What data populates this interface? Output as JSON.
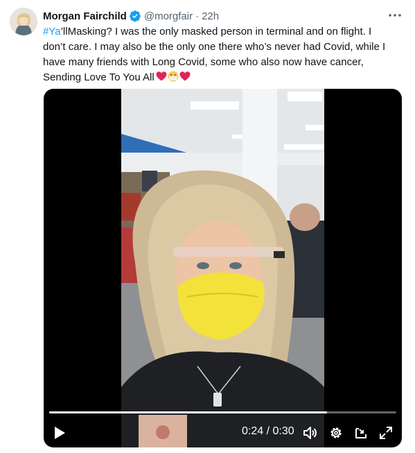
{
  "author": {
    "name": "Morgan Fairchild",
    "handle": "@morgfair",
    "separator": "·",
    "time": "22h",
    "verified": true,
    "verified_color": "#1d9bf0"
  },
  "tweet": {
    "hashtag": "#Ya",
    "line1_rest": "’llMasking? I was the only masked person in terminal and on flight. I",
    "line2": "don’t care. I may also be the only one there who’s never had Covid, while I",
    "line3": "have many  friends with Long Covid, some who also now have cancer,",
    "line4": "Sending Love To You All",
    "emojis": [
      "heart",
      "face-with-medical-mask",
      "heart"
    ]
  },
  "video": {
    "current_time": "0:24",
    "separator": " / ",
    "duration": "0:30",
    "progress": 0.8,
    "controls": [
      "play-icon",
      "volume-icon",
      "settings-icon",
      "pop-out-icon",
      "fullscreen-icon"
    ]
  },
  "more_label": "···",
  "colors": {
    "accent": "#1d9bf0",
    "text": "#0f1419",
    "muted": "#536471",
    "heart": "#e0245e",
    "mask": "#f2e23a"
  }
}
